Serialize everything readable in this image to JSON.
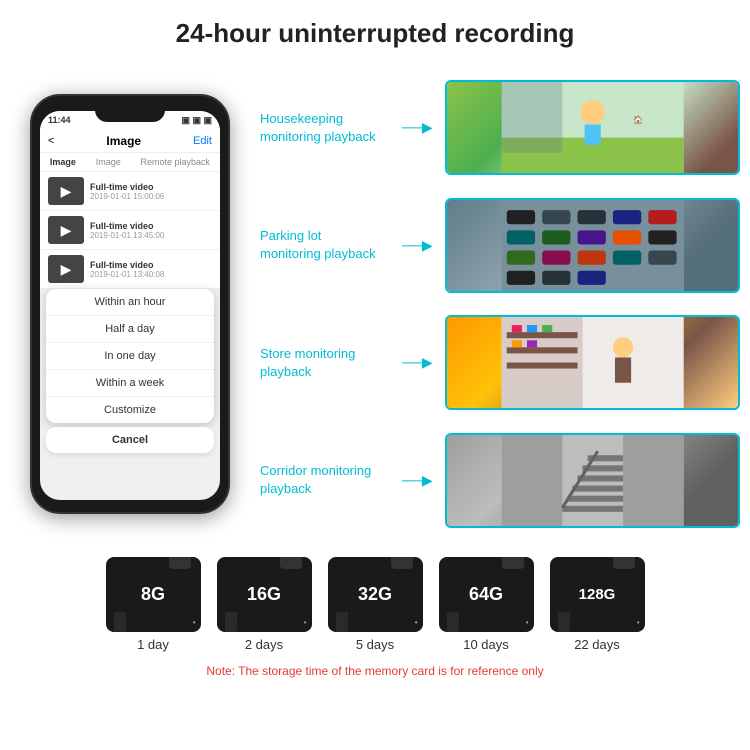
{
  "header": {
    "title": "24-hour uninterrupted recording"
  },
  "phone": {
    "time": "11:44",
    "nav": {
      "back": "<",
      "title": "Image",
      "edit": "Edit"
    },
    "tabs": [
      "Image",
      "Image",
      "Remote playback"
    ],
    "videos": [
      {
        "title": "Full-time video",
        "date": "2019-01-01 15:00:06"
      },
      {
        "title": "Full-time video",
        "date": "2019-01-01 13:45:00"
      },
      {
        "title": "Full-time video",
        "date": "2019-01-01 13:40:08"
      }
    ],
    "menu_items": [
      "Within an hour",
      "Half a day",
      "In one day",
      "Within a week",
      "Customize"
    ],
    "cancel_label": "Cancel"
  },
  "monitoring": [
    {
      "label": "Housekeeping\nmonitoring playback",
      "scene": "child"
    },
    {
      "label": "Parking lot\nmonitoring playback",
      "scene": "parking"
    },
    {
      "label": "Store monitoring\nplayback",
      "scene": "store"
    },
    {
      "label": "Corridor monitoring\nplayback",
      "scene": "corridor"
    }
  ],
  "storage": {
    "cards": [
      {
        "size": "8G",
        "days": "1 day"
      },
      {
        "size": "16G",
        "days": "2 days"
      },
      {
        "size": "32G",
        "days": "5 days"
      },
      {
        "size": "64G",
        "days": "10 days"
      },
      {
        "size": "128G",
        "days": "22 days"
      }
    ],
    "note": "Note: The storage time of the memory card is for reference only"
  }
}
